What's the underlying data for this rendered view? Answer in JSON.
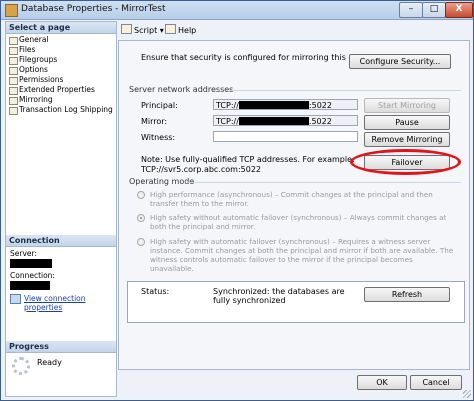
{
  "window": {
    "title": "Database Properties - MirrorTest",
    "controls": {
      "minimize": "–",
      "maximize": "□",
      "close": "X"
    }
  },
  "left_panel": {
    "select_page_header": "Select a page",
    "pages": [
      "General",
      "Files",
      "Filegroups",
      "Options",
      "Permissions",
      "Extended Properties",
      "Mirroring",
      "Transaction Log Shipping"
    ],
    "connection_header": "Connection",
    "server_label": "Server:",
    "connection_label": "Connection:",
    "view_connection_link": "View connection properties",
    "progress_header": "Progress",
    "progress_status": "Ready"
  },
  "toolbar": {
    "script_label": "Script",
    "help_label": "Help"
  },
  "security": {
    "text": "Ensure that security is configured for mirroring this database.",
    "configure_button": "Configure Security..."
  },
  "server_network": {
    "header": "Server network addresses",
    "principal_label": "Principal:",
    "principal_prefix": "TCP://",
    "principal_suffix": ":5022",
    "mirror_label": "Mirror:",
    "mirror_prefix": "TCP://",
    "mirror_suffix": ".5022",
    "witness_label": "Witness:",
    "witness_value": "",
    "start_mirroring_button": "Start Mirroring",
    "pause_button": "Pause",
    "remove_mirroring_button": "Remove Mirroring",
    "failover_button": "Failover",
    "note_line1": "Note: Use fully-qualified TCP addresses. For example:",
    "note_line2": "TCP://svr5.corp.abc.com:5022"
  },
  "operating_mode": {
    "header": "Operating mode",
    "option1": "High performance (asynchronous) – Commit changes at the principal and then transfer them to the mirror.",
    "option2": "High safety without automatic failover (synchronous) – Always commit changes at both the principal and mirror.",
    "option3": "High safety with automatic failover (synchronous) – Requires a witness server instance. Commit changes at both the principal and mirror if both are available. The witness controls automatic failover to the mirror if the principal becomes unavailable.",
    "selected": "option2"
  },
  "status": {
    "label": "Status:",
    "value": "Synchronized: the databases are fully synchronized",
    "refresh_button": "Refresh"
  },
  "footer": {
    "ok_button": "OK",
    "cancel_button": "Cancel"
  },
  "colors": {
    "highlight_ring": "#e3121b",
    "link": "#1a3fb0"
  }
}
